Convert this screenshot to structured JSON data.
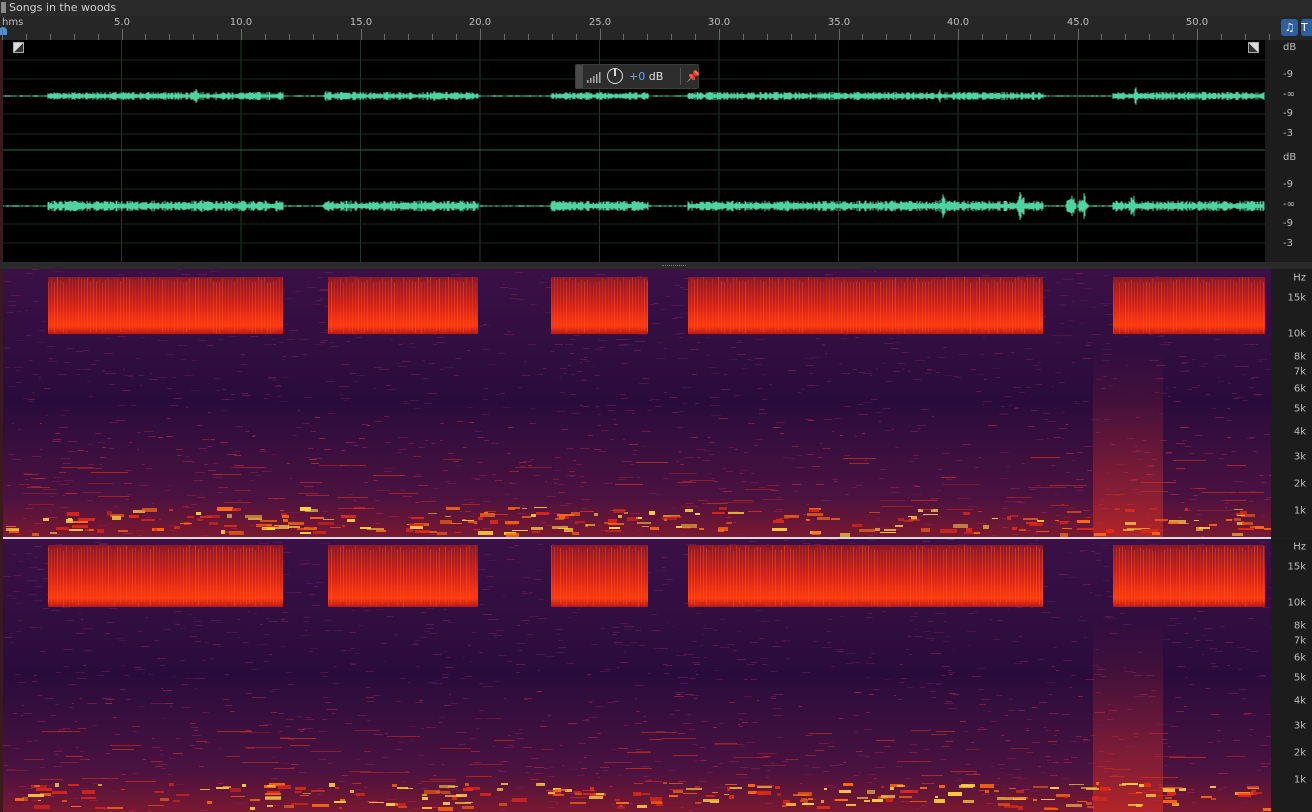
{
  "title": "Songs in the woods",
  "ruler": {
    "unit": "hms",
    "ticks": [
      "5.0",
      "10.0",
      "15.0",
      "20.0",
      "25.0",
      "30.0",
      "35.0",
      "40.0",
      "45.0",
      "50.0"
    ]
  },
  "waveform": {
    "db_scale_ch1": [
      "dB",
      "-9",
      "-∞",
      "-9",
      "-3"
    ],
    "db_scale_ch2": [
      "dB",
      "-9",
      "-∞",
      "-9",
      "-3"
    ],
    "color": "#4fd3a0"
  },
  "gain_hud": {
    "value": "+0",
    "unit": " dB"
  },
  "spectral": {
    "hz_scale_ch1": [
      "Hz",
      "15k",
      "10k",
      "8k",
      "7k",
      "6k",
      "5k",
      "4k",
      "3k",
      "2k",
      "1k"
    ],
    "hz_scale_ch2": [
      "Hz",
      "15k",
      "10k",
      "8k",
      "7k",
      "6k",
      "5k",
      "4k",
      "3k",
      "2k",
      "1k"
    ]
  },
  "tools": {
    "headphones_icon": "headphones-icon",
    "tool_icon": "selection-tool-icon"
  }
}
